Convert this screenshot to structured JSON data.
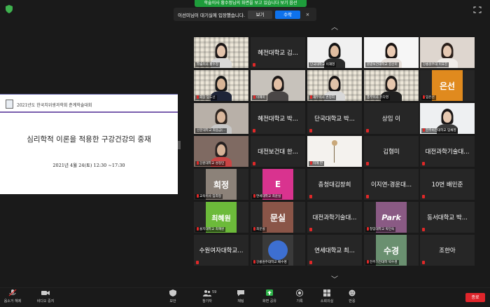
{
  "banners": {
    "share_notice": "학술이사 황수정님의 화면을 보고 있습니다",
    "share_options": "보기 옵션",
    "waiting_msg": "이선미님이 대기실에 입장했습니다.",
    "view_label": "보기",
    "admit_label": "수락"
  },
  "slide": {
    "conference": "2021년도 한국치위생과학회 춘계학술대회",
    "title": "심리학적 이론을 적용한 구강건강의 중재",
    "date": "2021년 4월 24(토) 12:30 ~17:30"
  },
  "tiles": [
    {
      "name": "학술이사 황수정",
      "big": "",
      "muted": false,
      "active": true
    },
    {
      "name": "",
      "big": "혜전대학교 김...",
      "muted": true
    },
    {
      "name": "단국대학교 이재영",
      "big": "",
      "muted": false
    },
    {
      "name": "원광보건대학교 김선미",
      "big": "",
      "muted": false
    },
    {
      "name": "강릉원주대 이효진",
      "big": "",
      "muted": false
    },
    {
      "name": "회장 임도선",
      "big": "",
      "muted": true
    },
    {
      "name": "이혜미",
      "big": "",
      "muted": true
    },
    {
      "name": "재무이사 손정희",
      "big": "",
      "muted": true
    },
    {
      "name": "총무이사 유다영",
      "big": "",
      "muted": false
    },
    {
      "name": "임은선",
      "big": "",
      "muted": true,
      "block": "은선",
      "block_color": "#e08a1e"
    },
    {
      "name": "선문대학교 최용금(...",
      "big": "",
      "muted": false
    },
    {
      "name": "",
      "big": "혜전대학교 박...",
      "muted": true
    },
    {
      "name": "",
      "big": "단국대학교 박...",
      "muted": true
    },
    {
      "name": "",
      "big": "상임 이",
      "muted": true
    },
    {
      "name": "전주비전대학교 임채영",
      "big": "",
      "muted": true
    },
    {
      "name": "강원대학교 성정민",
      "big": "",
      "muted": true
    },
    {
      "name": "",
      "big": "대전보건대 한...",
      "muted": true
    },
    {
      "name": "지혜 한",
      "big": "",
      "muted": true
    },
    {
      "name": "",
      "big": "김형미",
      "muted": true
    },
    {
      "name": "",
      "big": "대전과학기술대...",
      "muted": true
    },
    {
      "name": "교육이사 임희정",
      "big": "",
      "muted": true,
      "block": "희정",
      "block_color": "#8c8279"
    },
    {
      "name": "연세대학교 최윤실",
      "big": "",
      "muted": true,
      "block": "E",
      "block_color": "#d9338f"
    },
    {
      "name": "",
      "big": "충청대김창희",
      "muted": true
    },
    {
      "name": "",
      "big": "이지연-경운대...",
      "muted": true
    },
    {
      "name": "",
      "big": "10번 배민준",
      "muted": true
    },
    {
      "name": "을지대학교 최혜원",
      "big": "",
      "muted": true,
      "block": "최혜원",
      "block_color": "#6cba3a"
    },
    {
      "name": "최문실",
      "big": "",
      "muted": true,
      "block": "문실",
      "block_color": "#8a5548"
    },
    {
      "name": "",
      "big": "대전과학기술대...",
      "muted": true
    },
    {
      "name": "청암대학교 박민숙",
      "big": "",
      "muted": true,
      "block": "Park",
      "block_color": "#8a5a84"
    },
    {
      "name": "",
      "big": "동서대학교 박...",
      "muted": true
    },
    {
      "name": "",
      "big": "수원여자대학교...",
      "muted": true
    },
    {
      "name": "강릉원주대학교 배수명",
      "big": "",
      "muted": true,
      "block": "",
      "block_color": "#3d6fd1"
    },
    {
      "name": "",
      "big": "연세대학교 최...",
      "muted": true
    },
    {
      "name": "전주기전대학 박수경",
      "big": "",
      "muted": true,
      "block": "수경",
      "block_color": "#6a9070"
    },
    {
      "name": "",
      "big": "조한아",
      "muted": true
    }
  ],
  "toolbar": {
    "audio": "음소거 해제",
    "video": "비디오 중지",
    "security": "보안",
    "participants": "참가자",
    "participants_count": "59",
    "chat": "채팅",
    "share": "화면 공유",
    "record": "기록",
    "breakout": "소회의실",
    "reactions": "반응",
    "end": "종료"
  },
  "icons": {
    "shield": "shield-icon",
    "fullscreen": "fullscreen-icon"
  }
}
